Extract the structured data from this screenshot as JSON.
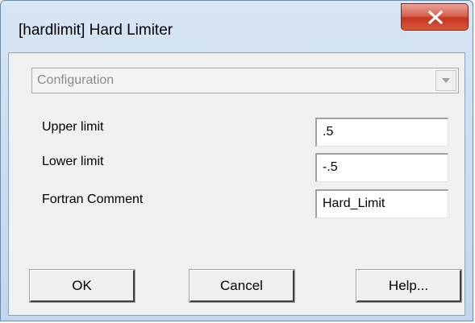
{
  "window": {
    "title": "[hardlimit] Hard Limiter",
    "close_icon": "close-x-icon"
  },
  "config": {
    "selected": "Configuration",
    "arrow_icon": "chevron-down-icon"
  },
  "fields": {
    "upper": {
      "label": "Upper limit",
      "value": ".5"
    },
    "lower": {
      "label": "Lower limit",
      "value": "-.5"
    },
    "comment": {
      "label": "Fortran Comment",
      "value": "Hard_Limit"
    }
  },
  "buttons": {
    "ok": "OK",
    "cancel": "Cancel",
    "help": "Help..."
  }
}
